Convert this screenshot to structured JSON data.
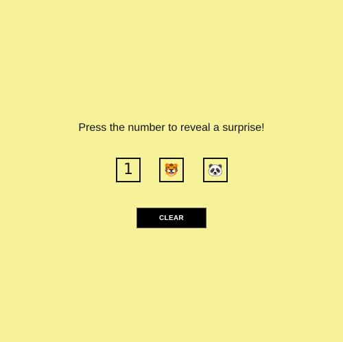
{
  "prompt": {
    "text": "Press the number to reveal a surprise!"
  },
  "tiles": [
    {
      "content": "1",
      "kind": "number"
    },
    {
      "content": "🐯",
      "kind": "emoji",
      "icon": "tiger-face-icon"
    },
    {
      "content": "🐼",
      "kind": "emoji",
      "icon": "panda-face-icon"
    }
  ],
  "clear_button": {
    "label": "CLEAR"
  },
  "colors": {
    "background": "#f7f29a",
    "text": "#111111",
    "button_bg": "#000000",
    "button_text": "#ffffff"
  }
}
